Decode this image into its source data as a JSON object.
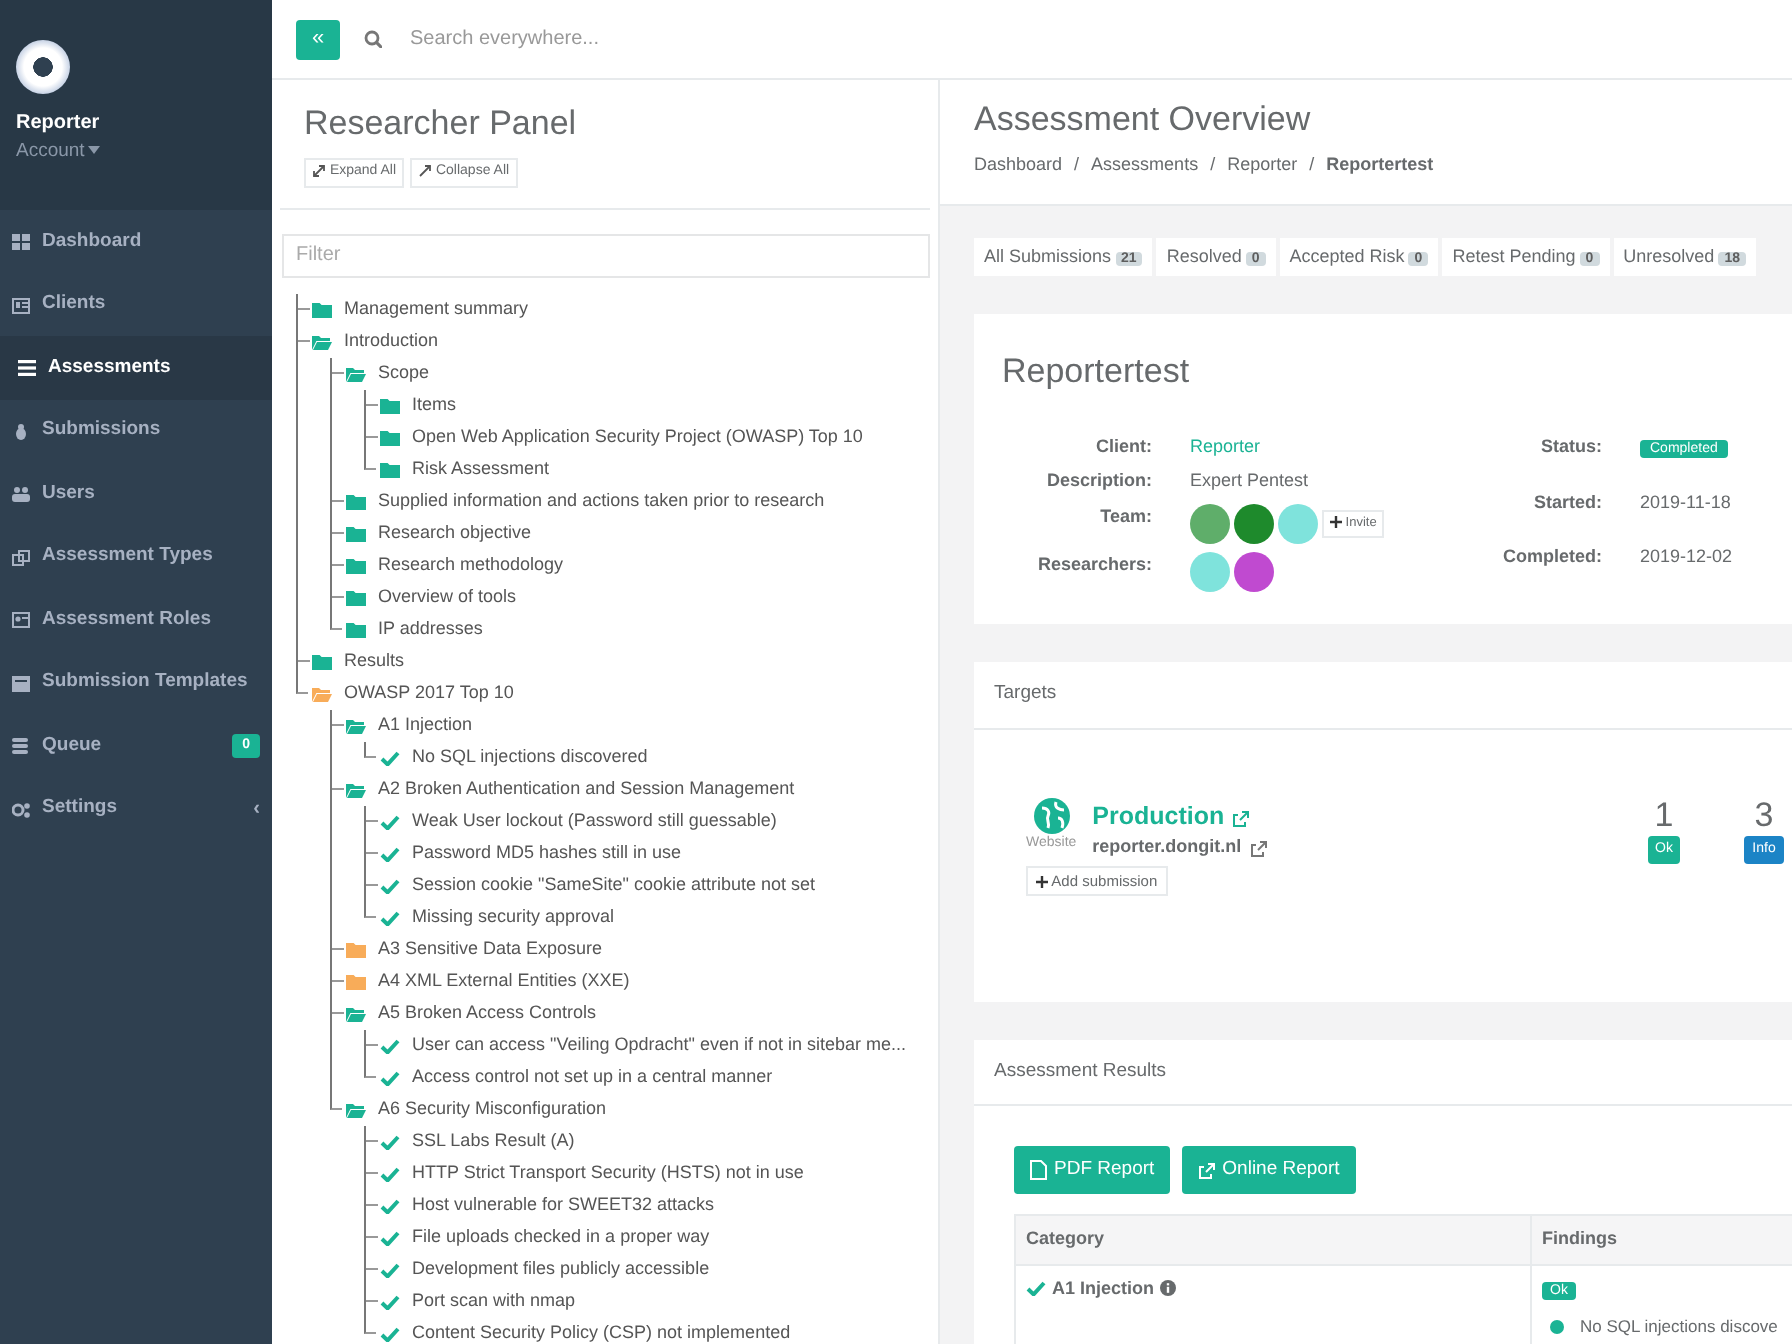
{
  "sidebar": {
    "brand": "Reporter",
    "account": "Account",
    "items": [
      {
        "label": "Dashboard",
        "selected": false
      },
      {
        "label": "Clients",
        "selected": false
      },
      {
        "label": "Assessments",
        "selected": true
      },
      {
        "label": "Submissions",
        "selected": false
      },
      {
        "label": "Users",
        "selected": false
      },
      {
        "label": "Assessment Types",
        "selected": false
      },
      {
        "label": "Assessment Roles",
        "selected": false
      },
      {
        "label": "Submission Templates",
        "selected": false
      },
      {
        "label": "Queue",
        "selected": false,
        "badge": "0"
      },
      {
        "label": "Settings",
        "selected": false,
        "chevron": "‹"
      }
    ]
  },
  "topbar": {
    "collapse_button": "«",
    "search_placeholder": "Search everywhere..."
  },
  "researcher_panel": {
    "title": "Researcher Panel",
    "buttons": [
      "Expand All",
      "Collapse All"
    ],
    "filter_placeholder": "Filter",
    "tree": [
      {
        "label": "Management summary",
        "kind": "folder",
        "color": "#1ab394",
        "expanded": false
      },
      {
        "label": "Introduction",
        "kind": "folder",
        "color": "#1ab394",
        "expanded": true,
        "children": [
          {
            "label": "Scope",
            "kind": "folder",
            "color": "#1ab394",
            "expanded": true,
            "children": [
              {
                "label": "Items",
                "kind": "folder",
                "color": "#1ab394",
                "expanded": false
              },
              {
                "label": "Open Web Application Security Project (OWASP) Top 10",
                "kind": "folder",
                "color": "#1ab394",
                "expanded": false
              },
              {
                "label": "Risk Assessment",
                "kind": "folder",
                "color": "#1ab394",
                "expanded": false
              }
            ]
          },
          {
            "label": "Supplied information and actions taken prior to research",
            "kind": "folder",
            "color": "#1ab394",
            "expanded": false
          },
          {
            "label": "Research objective",
            "kind": "folder",
            "color": "#1ab394",
            "expanded": false
          },
          {
            "label": "Research methodology",
            "kind": "folder",
            "color": "#1ab394",
            "expanded": false
          },
          {
            "label": "Overview of tools",
            "kind": "folder",
            "color": "#1ab394",
            "expanded": false
          },
          {
            "label": "IP addresses",
            "kind": "folder",
            "color": "#1ab394",
            "expanded": false
          }
        ]
      },
      {
        "label": "Results",
        "kind": "folder",
        "color": "#1ab394",
        "expanded": false
      },
      {
        "label": "OWASP 2017 Top 10",
        "kind": "folder",
        "color": "#f8ac59",
        "expanded": true,
        "children": [
          {
            "label": "A1 Injection",
            "kind": "folder",
            "color": "#1ab394",
            "expanded": true,
            "children": [
              {
                "label": "No SQL injections discovered",
                "kind": "finding"
              }
            ]
          },
          {
            "label": "A2 Broken Authentication and Session Management",
            "kind": "folder",
            "color": "#1ab394",
            "expanded": true,
            "children": [
              {
                "label": "Weak User lockout (Password still guessable)",
                "kind": "finding"
              },
              {
                "label": "Password MD5 hashes still in use",
                "kind": "finding"
              },
              {
                "label": "Session cookie \"SameSite\" cookie attribute not set",
                "kind": "finding"
              },
              {
                "label": "Missing security approval",
                "kind": "finding"
              }
            ]
          },
          {
            "label": "A3 Sensitive Data Exposure",
            "kind": "folder",
            "color": "#f8ac59",
            "expanded": false
          },
          {
            "label": "A4 XML External Entities (XXE)",
            "kind": "folder",
            "color": "#f8ac59",
            "expanded": false
          },
          {
            "label": "A5 Broken Access Controls",
            "kind": "folder",
            "color": "#1ab394",
            "expanded": true,
            "children": [
              {
                "label": "User can access \"Veiling Opdracht\" even if not in sitebar me...",
                "kind": "finding"
              },
              {
                "label": "Access control not set up in a central manner",
                "kind": "finding"
              }
            ]
          },
          {
            "label": "A6 Security Misconfiguration",
            "kind": "folder",
            "color": "#1ab394",
            "expanded": true,
            "children": [
              {
                "label": "SSL Labs Result (A)",
                "kind": "finding"
              },
              {
                "label": "HTTP Strict Transport Security (HSTS) not in use",
                "kind": "finding"
              },
              {
                "label": "Host vulnerable for SWEET32 attacks",
                "kind": "finding"
              },
              {
                "label": "File uploads checked in a proper way",
                "kind": "finding"
              },
              {
                "label": "Development files publicly accessible",
                "kind": "finding"
              },
              {
                "label": "Port scan with nmap",
                "kind": "finding"
              },
              {
                "label": "Content Security Policy (CSP) not implemented",
                "kind": "finding"
              }
            ]
          }
        ]
      }
    ]
  },
  "overview": {
    "title": "Assessment Overview",
    "breadcrumb": [
      {
        "label": "Dashboard",
        "separator": "/",
        "current": false
      },
      {
        "label": "Assessments",
        "separator": "/",
        "current": false
      },
      {
        "label": "Reporter",
        "separator": "/",
        "current": false
      },
      {
        "label": "Reportertest",
        "current": true
      }
    ],
    "filters": [
      {
        "label": "All Submissions",
        "count": "21"
      },
      {
        "label": "Resolved",
        "count": "0"
      },
      {
        "label": "Accepted Risk",
        "count": "0"
      },
      {
        "label": "Retest Pending",
        "count": "0"
      },
      {
        "label": "Unresolved",
        "count": "18"
      }
    ],
    "assessment": {
      "title": "Reportertest",
      "left_fields": [
        {
          "label": "Client:",
          "kind": "link",
          "value": "Reporter"
        },
        {
          "label": "Description:",
          "kind": "text",
          "value": "Expert Pentest"
        },
        {
          "label": "Team:",
          "kind": "avatars",
          "avatars": [
            {
              "color": "#5fae6a"
            },
            {
              "color": "#1e8a2c"
            },
            {
              "color": "#7fe3dc"
            }
          ],
          "invite": "Invite"
        },
        {
          "label": "Researchers:",
          "kind": "avatars",
          "avatars": [
            {
              "color": "#7fe3dc"
            },
            {
              "color": "#c04ad0"
            }
          ]
        }
      ],
      "right_fields": [
        {
          "label": "Status:",
          "kind": "badge",
          "value": "Completed"
        },
        {
          "label": "Started:",
          "kind": "text",
          "value": "2019-11-18"
        },
        {
          "label": "Completed:",
          "kind": "text",
          "value": "2019-12-02"
        }
      ]
    },
    "targets": {
      "title": "Targets",
      "items": [
        {
          "name": "Production",
          "url": "reporter.dongit.nl",
          "type": "Website",
          "add_button": "Add submission",
          "stats": [
            {
              "count": "1",
              "label": "Ok",
              "color": "#1ab394"
            },
            {
              "count": "3",
              "label": "Info",
              "color": "#1c84c6"
            }
          ]
        }
      ]
    },
    "results": {
      "title": "Assessment Results",
      "buttons": [
        "PDF Report",
        "Online Report"
      ],
      "table": {
        "columns": [
          "Category",
          "Findings"
        ],
        "rows": [
          {
            "category": "A1 Injection",
            "passed": true,
            "badge": "Ok",
            "findings": [
              "No SQL injections discove"
            ]
          }
        ]
      }
    }
  }
}
